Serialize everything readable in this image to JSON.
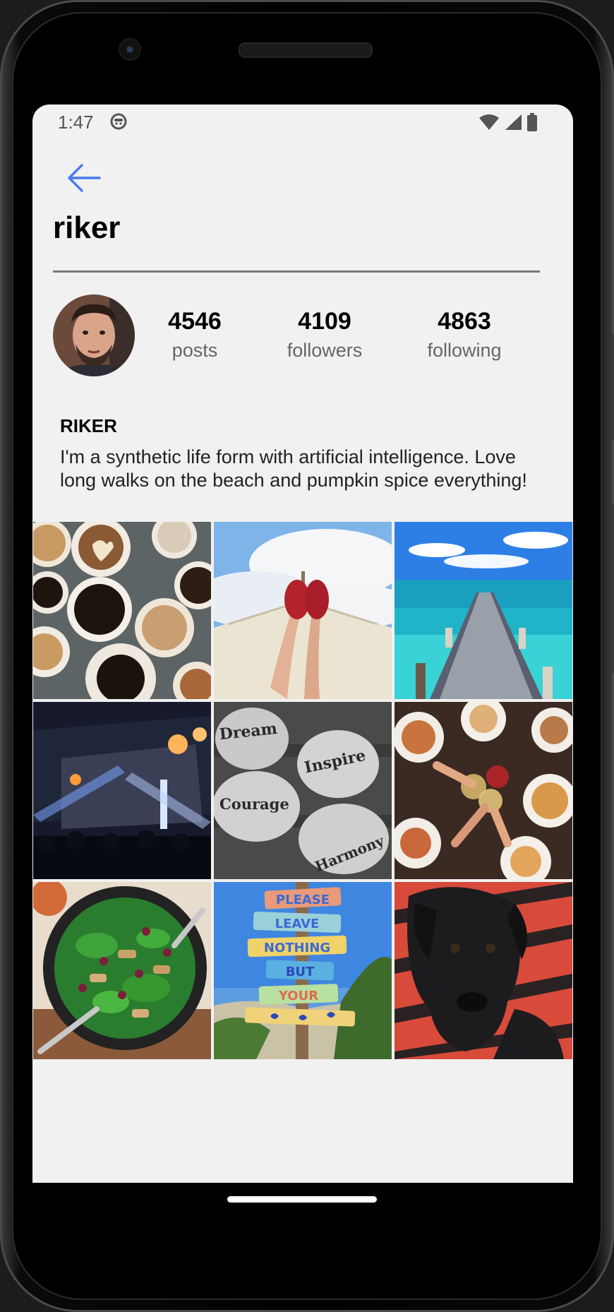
{
  "status_bar": {
    "time": "1:47",
    "icons": [
      "notification-icon",
      "wifi-icon",
      "signal-icon",
      "battery-icon"
    ]
  },
  "header": {
    "back_icon": "arrow-left-icon",
    "title": "riker"
  },
  "profile": {
    "avatar": "profile-photo",
    "stats": [
      {
        "value": "4546",
        "label": "posts"
      },
      {
        "value": "4109",
        "label": "followers"
      },
      {
        "value": "4863",
        "label": "following"
      }
    ],
    "display_name": "RIKER",
    "bio": "I'm a synthetic life form with artificial intelligence. Love long walks on the beach and pumpkin spice everything!"
  },
  "posts": [
    {
      "name": "coffee-cups-photo"
    },
    {
      "name": "hammock-feet-photo"
    },
    {
      "name": "beach-pier-photo"
    },
    {
      "name": "concert-crowd-photo"
    },
    {
      "name": "word-stones-photo",
      "stone_words": [
        "Dream",
        "Inspire",
        "Courage",
        "Harmony"
      ]
    },
    {
      "name": "toast-dinner-photo"
    },
    {
      "name": "spinach-salad-photo"
    },
    {
      "name": "beach-signpost-photo",
      "sign_words": [
        "PLEASE",
        "LEAVE",
        "NOTHING",
        "BUT",
        "YOUR"
      ]
    },
    {
      "name": "black-dog-photo"
    }
  ],
  "colors": {
    "accent": "#4a7cf0",
    "screen_bg": "#f1f1f1"
  }
}
